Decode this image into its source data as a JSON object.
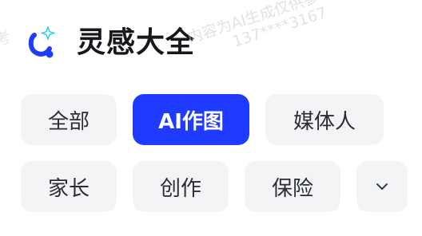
{
  "header": {
    "title": "灵感大全",
    "logo_icon": "stethoscope-sparkle-icon"
  },
  "watermark": {
    "line1": "内容为AI生成仅供参考",
    "line2": "137****3167",
    "left_fragment": "考"
  },
  "categories": {
    "items": [
      {
        "label": "全部",
        "selected": false
      },
      {
        "label": "AI作图",
        "selected": true
      },
      {
        "label": "媒体人",
        "selected": false
      },
      {
        "label": "家长",
        "selected": false
      },
      {
        "label": "创作",
        "selected": false
      },
      {
        "label": "保险",
        "selected": false
      }
    ],
    "expand_icon": "chevron-down-icon"
  },
  "colors": {
    "accent": "#1f3bff",
    "chip_bg": "#f3f4f6",
    "title": "#16181d",
    "chip_text": "#2b2d33"
  }
}
